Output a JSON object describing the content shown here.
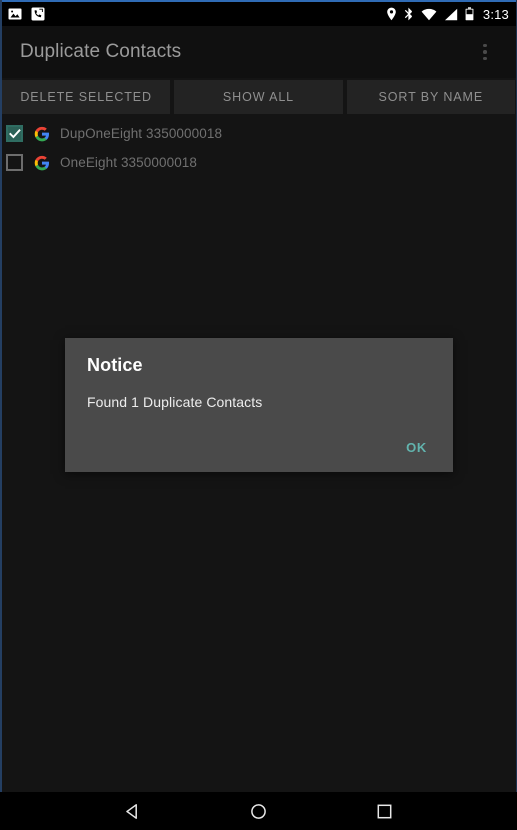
{
  "statusbar": {
    "left_icons": [
      {
        "name": "screenshot-icon"
      },
      {
        "name": "missed-call-icon"
      }
    ],
    "right_icons": [
      {
        "name": "location-icon"
      },
      {
        "name": "bluetooth-icon"
      },
      {
        "name": "wifi-icon"
      },
      {
        "name": "cellular-signal-icon"
      },
      {
        "name": "battery-icon"
      }
    ],
    "time": "3:13"
  },
  "appbar": {
    "title": "Duplicate Contacts",
    "overflow_icon": "more-vert-icon"
  },
  "toolbar": {
    "buttons": [
      {
        "label": "DELETE SELECTED"
      },
      {
        "label": "SHOW ALL"
      },
      {
        "label": "SORT BY NAME"
      }
    ]
  },
  "contacts": [
    {
      "name": "DupOneEight 3350000018",
      "checked": true,
      "account_icon": "google-icon"
    },
    {
      "name": "OneEight 3350000018",
      "checked": false,
      "account_icon": "google-icon"
    }
  ],
  "dialog": {
    "title": "Notice",
    "message": "Found 1 Duplicate Contacts",
    "ok_label": "OK"
  },
  "navbar": {
    "back_icon": "back-triangle-icon",
    "home_icon": "home-circle-icon",
    "recents_icon": "recents-square-icon"
  },
  "colors": {
    "accent_teal": "#62b4ae",
    "checkbox_checked": "#2c6157",
    "window_frame_blue": "#2f6bb5",
    "background": "#141414",
    "dialog_background": "#4a4a4a"
  }
}
